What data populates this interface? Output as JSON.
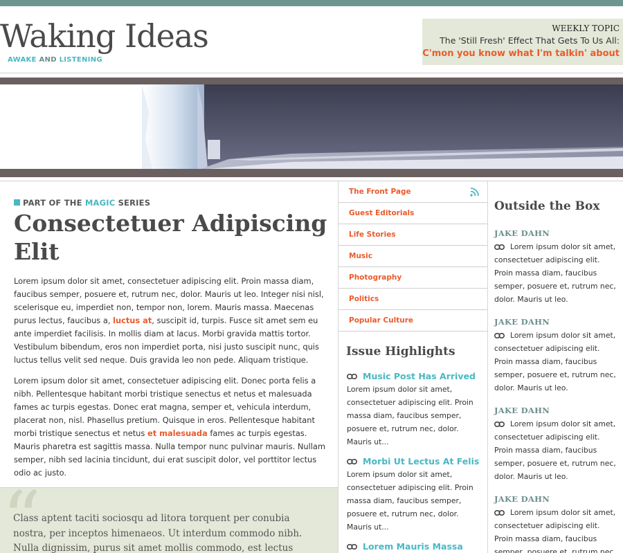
{
  "header": {
    "site_title": "Waking Ideas",
    "tagline_1": "AWAKE",
    "tagline_and": "AND",
    "tagline_2": "LISTENING"
  },
  "weekly_topic": {
    "label": "WEEKLY TOPIC",
    "line1": "The 'Still Fresh' Effect That Gets To Us All:",
    "line2": "C'mon you know what I'm talkin' about"
  },
  "colors": {
    "accent_teal": "#49b8c3",
    "accent_orange": "#ea5b2c",
    "topbar": "#6e9690",
    "panel_bg": "#e4e8d8"
  },
  "article": {
    "series_prefix": "PART OF THE",
    "series_name": "MAGIC",
    "series_suffix": "SERIES",
    "title": "Consectetuer Adipiscing Elit",
    "p1_a": "Lorem ipsum dolor sit amet, consectetuer adipiscing elit. Proin massa diam, faucibus semper, posuere et, rutrum nec, dolor. Mauris ut leo. Integer nisi nisl, scelerisque eu, imperdiet non, tempor non, lorem. Mauris massa. Maecenas purus lectus, faucibus a, ",
    "p1_link": "luctus at",
    "p1_b": ", suscipit id, turpis. Fusce sit amet sem eu ante imperdiet facilisis. In mollis diam at lacus. Morbi gravida mattis tortor. Vestibulum bibendum, eros non imperdiet porta, nisi justo suscipit nunc, quis luctus tellus velit sed neque. Duis gravida leo non pede. Aliquam tristique.",
    "p2_a": "Lorem ipsum dolor sit amet, consectetuer adipiscing elit. Donec porta felis a nibh. Pellentesque habitant morbi tristique senectus et netus et malesuada fames ac turpis egestas. Donec erat magna, semper et, vehicula interdum, placerat non, nisl. Phasellus pretium. Quisque in eros. Pellentesque habitant morbi tristique senectus et netus ",
    "p2_link": "et malesuada",
    "p2_b": " fames ac turpis egestas. Mauris pharetra est sagittis massa. Nulla tempor nunc pulvinar mauris. Nullam semper, nibh sed lacinia tincidunt, dui erat suscipit dolor, vel porttitor lectus odio ac justo.",
    "quote": "Class aptent taciti sociosqu ad litora torquent per conubia nostra, per inceptos himenaeos. Ut interdum commodo nibh. Nulla dignissim, purus sit amet mollis commodo, est lectus interdum justo, vel"
  },
  "nav": {
    "items": [
      {
        "label": "The Front Page"
      },
      {
        "label": "Guest Editorials"
      },
      {
        "label": "Life Stories"
      },
      {
        "label": "Music"
      },
      {
        "label": "Photography"
      },
      {
        "label": "Politics"
      },
      {
        "label": "Popular Culture"
      }
    ],
    "rss_icon": "rss-icon"
  },
  "highlights": {
    "heading": "Issue Highlights",
    "items": [
      {
        "title": "Music Post Has Arrived",
        "text": "Lorem ipsum dolor sit amet, consectetuer adipiscing elit. Proin massa diam, faucibus semper, posuere et, rutrum nec, dolor. Mauris ut..."
      },
      {
        "title": "Morbi Ut Lectus At Felis",
        "text": "Lorem ipsum dolor sit amet, consectetuer adipiscing elit. Proin massa diam, faucibus semper, posuere et, rutrum nec, dolor. Mauris ut..."
      },
      {
        "title": "Lorem Mauris Massa",
        "text": ""
      }
    ]
  },
  "outside": {
    "heading": "Outside the Box",
    "items": [
      {
        "author": "JAKE DAHN",
        "text": "Lorem ipsum dolor sit amet, consectetuer adipiscing elit. Proin massa diam, faucibus semper, posuere et, rutrum nec, dolor. Mauris ut leo."
      },
      {
        "author": "JAKE DAHN",
        "text": "Lorem ipsum dolor sit amet, consectetuer adipiscing elit. Proin massa diam, faucibus semper, posuere et, rutrum nec, dolor. Mauris ut leo."
      },
      {
        "author": "JAKE DAHN",
        "text": "Lorem ipsum dolor sit amet, consectetuer adipiscing elit. Proin massa diam, faucibus semper, posuere et, rutrum nec, dolor. Mauris ut leo."
      },
      {
        "author": "JAKE DAHN",
        "text": "Lorem ipsum dolor sit amet, consectetuer adipiscing elit. Proin massa diam, faucibus semper, posuere et, rutrum nec, dolor."
      }
    ]
  }
}
